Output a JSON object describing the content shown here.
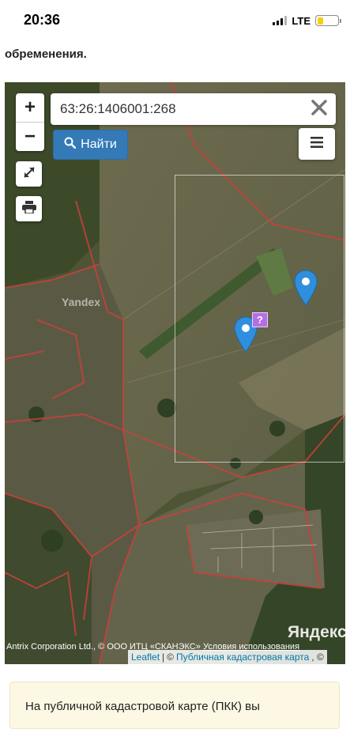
{
  "status_bar": {
    "time": "20:36",
    "network": "LTE",
    "battery_level": 0.3,
    "battery_color": "#f5d10a"
  },
  "article": {
    "heading_tail": "обременения."
  },
  "map": {
    "search": {
      "value": "63:26:1406001:268"
    },
    "find_button_label": "Найти",
    "zoom_in": "+",
    "zoom_out": "−",
    "marker_label": "?",
    "watermark": "Yandex",
    "logo": "Яндекс",
    "attribution": {
      "providers": "Antrix Corporation Ltd., © ООО ИТЦ «СКАНЭКС»",
      "terms": "Условия использования",
      "leaflet": "Leaflet",
      "separator": "|",
      "copyright_left": "©",
      "pkk": "Публичная кадастровая карта",
      "copyright_right": ", ©"
    },
    "icons": {
      "zoom_in": "plus-icon",
      "zoom_out": "minus-icon",
      "fullscreen": "fullscreen-icon",
      "print": "print-icon",
      "clear": "close-icon",
      "find": "search-icon",
      "menu": "menu-icon",
      "pin": "map-pin-icon"
    },
    "colors": {
      "button_primary": "#337ab7",
      "parcel_border": "#c8413b",
      "pin": "#2f8fde",
      "marker": "#b46ee6"
    }
  },
  "info": {
    "text": "На публичной кадастровой карте (ПКК) вы"
  }
}
